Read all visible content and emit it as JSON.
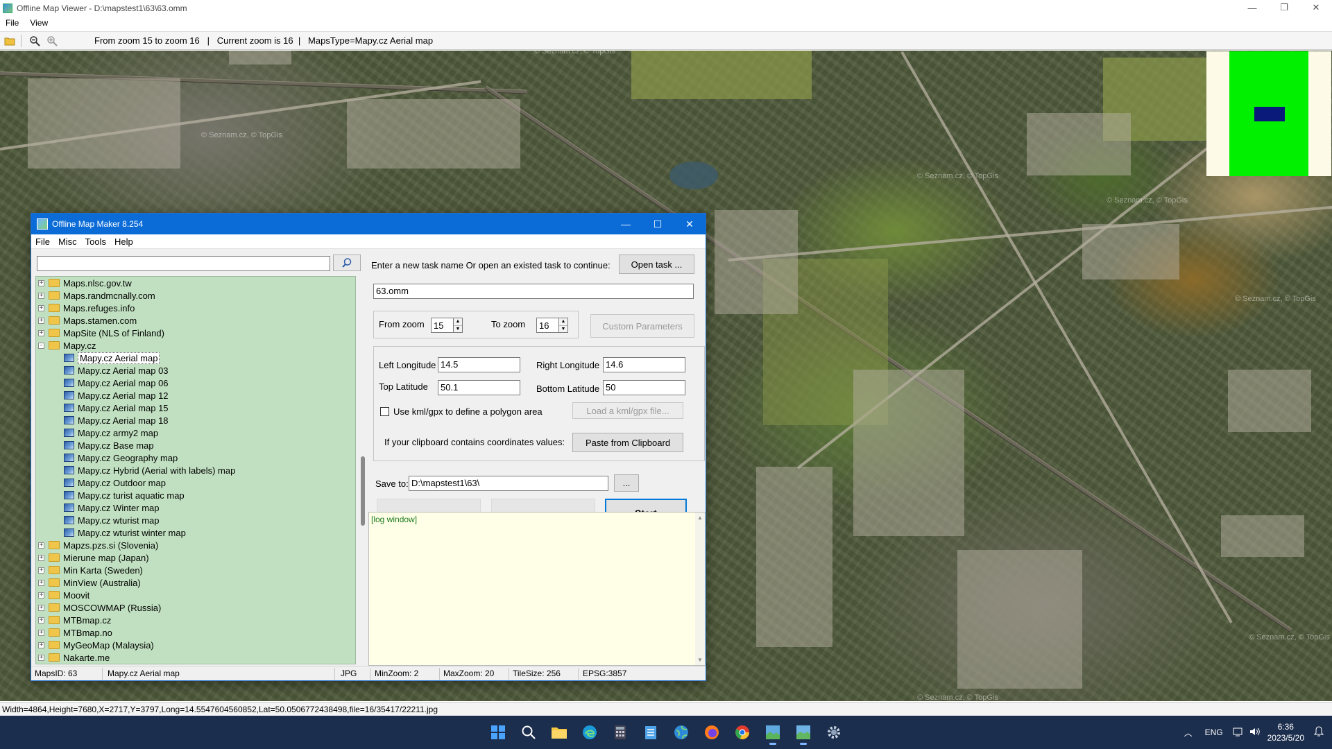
{
  "viewer": {
    "title": "Offline Map Viewer - D:\\mapstest1\\63\\63.omm",
    "menu": [
      "File",
      "View"
    ],
    "toolbar_text": "From zoom 15 to zoom 16   |   Current zoom is 16  |   MapsType=Mapy.cz Aerial map",
    "status_text": "Width=4864,Height=7680,X=2717,Y=3797,Long=14.5547604560852,Lat=50.0506772438498,file=16/35417/22211.jpg",
    "watermark": "© Seznam.cz, © TopGis",
    "minimap_colors": {
      "background": "#fdfae8",
      "viewport": "#00f000",
      "current_view": "#0a1a7a"
    }
  },
  "dialog": {
    "title": "Offline Map Maker 8.254",
    "menu": [
      "File",
      "Misc",
      "Tools",
      "Help"
    ],
    "search": {
      "value": "",
      "placeholder": ""
    },
    "tree": [
      {
        "label": "Maps.nlsc.gov.tw",
        "type": "folder",
        "expander": "+"
      },
      {
        "label": "Maps.randmcnally.com",
        "type": "folder",
        "expander": "+"
      },
      {
        "label": "Maps.refuges.info",
        "type": "folder",
        "expander": "+"
      },
      {
        "label": "Maps.stamen.com",
        "type": "folder",
        "expander": "+"
      },
      {
        "label": "MapSite (NLS of Finland)",
        "type": "folder",
        "expander": "+"
      },
      {
        "label": "Mapy.cz",
        "type": "folder",
        "expander": "-"
      },
      {
        "label": "Mapy.cz Aerial map",
        "type": "map",
        "selected": true
      },
      {
        "label": "Mapy.cz Aerial map 03",
        "type": "map"
      },
      {
        "label": "Mapy.cz Aerial map 06",
        "type": "map"
      },
      {
        "label": "Mapy.cz Aerial map 12",
        "type": "map"
      },
      {
        "label": "Mapy.cz Aerial map 15",
        "type": "map"
      },
      {
        "label": "Mapy.cz Aerial map 18",
        "type": "map"
      },
      {
        "label": "Mapy.cz army2 map",
        "type": "map"
      },
      {
        "label": "Mapy.cz Base map",
        "type": "map"
      },
      {
        "label": "Mapy.cz Geography map",
        "type": "map"
      },
      {
        "label": "Mapy.cz Hybrid (Aerial with labels) map",
        "type": "map"
      },
      {
        "label": "Mapy.cz Outdoor map",
        "type": "map"
      },
      {
        "label": "Mapy.cz turist aquatic map",
        "type": "map"
      },
      {
        "label": "Mapy.cz Winter map",
        "type": "map"
      },
      {
        "label": "Mapy.cz wturist map",
        "type": "map"
      },
      {
        "label": "Mapy.cz wturist winter map",
        "type": "map"
      },
      {
        "label": "Mapzs.pzs.si (Slovenia)",
        "type": "folder",
        "expander": "+"
      },
      {
        "label": "Mierune map (Japan)",
        "type": "folder",
        "expander": "+"
      },
      {
        "label": "Min Karta (Sweden)",
        "type": "folder",
        "expander": "+"
      },
      {
        "label": "MinView (Australia)",
        "type": "folder",
        "expander": "+"
      },
      {
        "label": "Moovit",
        "type": "folder",
        "expander": "+"
      },
      {
        "label": "MOSCOWMAP (Russia)",
        "type": "folder",
        "expander": "+"
      },
      {
        "label": "MTBmap.cz",
        "type": "folder",
        "expander": "+"
      },
      {
        "label": "MTBmap.no",
        "type": "folder",
        "expander": "+"
      },
      {
        "label": "MyGeoMap (Malaysia)",
        "type": "folder",
        "expander": "+"
      },
      {
        "label": "Nakarte.me",
        "type": "folder",
        "expander": "+"
      }
    ],
    "task_prompt": "Enter a new task name Or open an existed task to continue:",
    "open_task_label": "Open task ...",
    "task_name": "63.omm",
    "from_zoom_label": "From zoom",
    "from_zoom": "15",
    "to_zoom_label": "To zoom",
    "to_zoom": "16",
    "custom_params_label": "Custom Parameters",
    "left_lon_label": "Left Longitude",
    "left_lon": "14.5",
    "right_lon_label": "Right Longitude",
    "right_lon": "14.6",
    "top_lat_label": "Top Latitude",
    "top_lat": "50.1",
    "bottom_lat_label": "Bottom Latitude",
    "bottom_lat": "50",
    "kml_check_label": "Use kml/gpx to define a polygon area",
    "load_kml_label": "Load a kml/gpx file...",
    "clipboard_prompt": "If your clipboard contains coordinates values:",
    "paste_label": "Paste from Clipboard",
    "save_to_label": "Save to:",
    "save_to": "D:\\mapstest1\\63\\",
    "browse_label": "...",
    "start_label": "Start",
    "log_text": "[log window]",
    "status": {
      "maps_id": "MapsID: 63",
      "map_name": "Mapy.cz Aerial map",
      "format": "JPG",
      "min_zoom": "MinZoom: 2",
      "max_zoom": "MaxZoom: 20",
      "tile_size": "TileSize: 256",
      "epsg": "EPSG:3857"
    }
  },
  "taskbar": {
    "language": "ENG",
    "time": "6:36",
    "date": "2023/5/20"
  }
}
